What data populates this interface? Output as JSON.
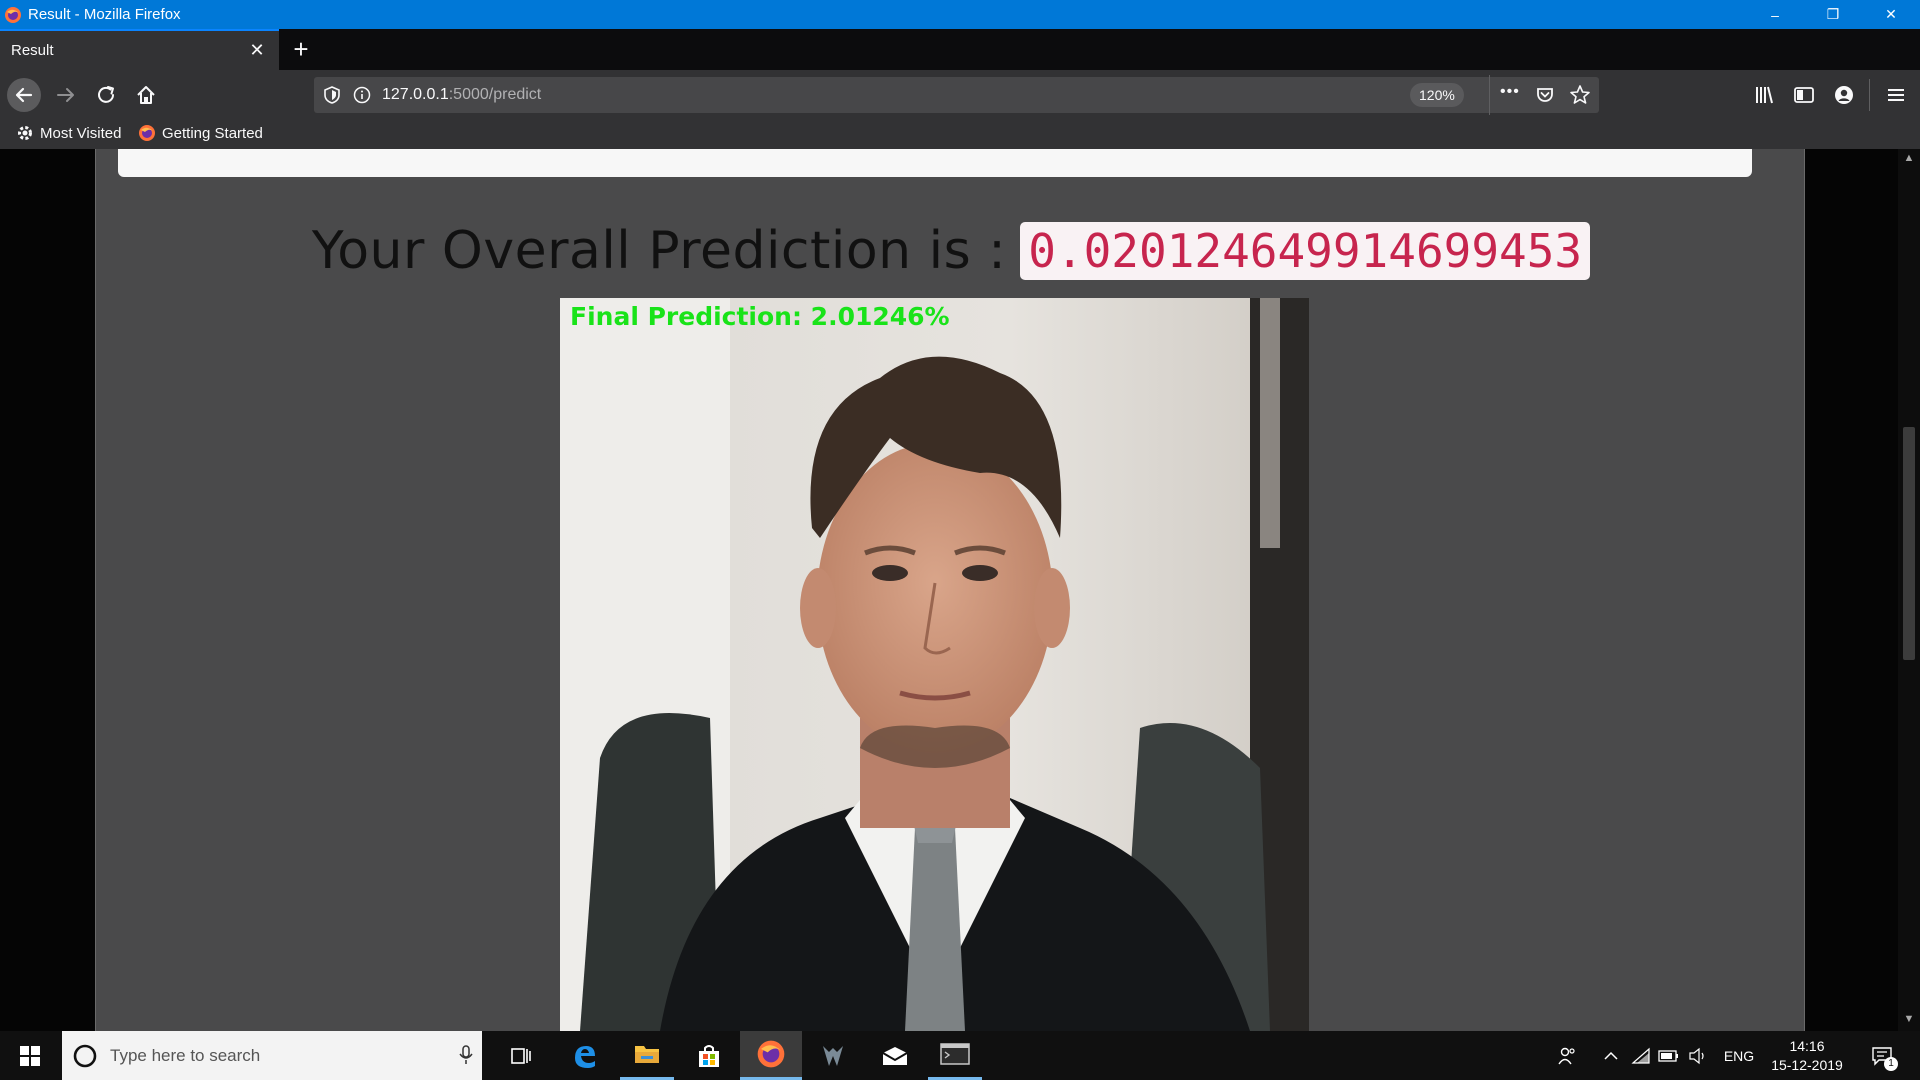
{
  "window": {
    "title": "Result - Mozilla Firefox",
    "controls": {
      "minimize": "–",
      "restore": "❐",
      "close": "✕"
    }
  },
  "tabs": [
    {
      "label": "Result",
      "active": true
    }
  ],
  "newtab_label": "+",
  "navbar": {
    "url_host": "127.0.0.1",
    "url_path": ":5000/predict",
    "zoom": "120%",
    "more": "•••"
  },
  "bookmarks": [
    {
      "label": "Most Visited",
      "icon": "gear-icon"
    },
    {
      "label": "Getting Started",
      "icon": "firefox-icon"
    }
  ],
  "page": {
    "heading_text": "Your Overall Prediction is :",
    "prediction_value": "0.020124649914699453",
    "image_overlay_text": "Final Prediction: 2.01246%"
  },
  "taskbar": {
    "search_placeholder": "Type here to search",
    "language": "ENG",
    "time": "14:16",
    "date": "15-12-2019",
    "notification_count": "1"
  },
  "colors": {
    "titlebar": "#0078d7",
    "prediction_code_text": "#c7254e",
    "overlay_green": "#19e319",
    "page_background": "#4a4a4b"
  }
}
